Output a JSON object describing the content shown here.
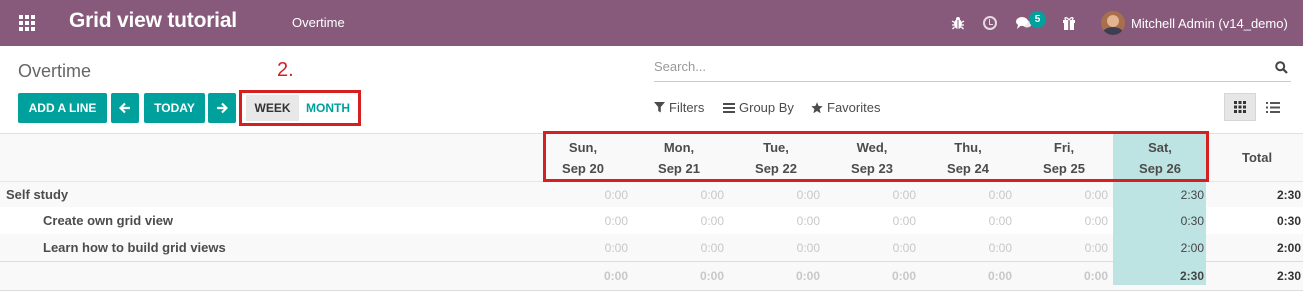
{
  "navbar": {
    "brand": "Grid view tutorial",
    "menu": "Overtime",
    "message_count": "5",
    "user": "Mitchell Admin (v14_demo)"
  },
  "control": {
    "breadcrumb": "Overtime",
    "annotation": "2.",
    "search_placeholder": "Search...",
    "add_line": "ADD A LINE",
    "today": "TODAY",
    "week": "WEEK",
    "month": "MONTH",
    "filters": "Filters",
    "group_by": "Group By",
    "favorites": "Favorites"
  },
  "grid": {
    "days": [
      {
        "day": "Sun,",
        "date": "Sep 20"
      },
      {
        "day": "Mon,",
        "date": "Sep 21"
      },
      {
        "day": "Tue,",
        "date": "Sep 22"
      },
      {
        "day": "Wed,",
        "date": "Sep 23"
      },
      {
        "day": "Thu,",
        "date": "Sep 24"
      },
      {
        "day": "Fri,",
        "date": "Sep 25"
      },
      {
        "day": "Sat,",
        "date": "Sep 26"
      }
    ],
    "total_label": "Total",
    "rows": [
      {
        "label": "Self study",
        "values": [
          "0:00",
          "0:00",
          "0:00",
          "0:00",
          "0:00",
          "0:00",
          "2:30"
        ],
        "total": "2:30"
      },
      {
        "label": "Create own grid view",
        "values": [
          "0:00",
          "0:00",
          "0:00",
          "0:00",
          "0:00",
          "0:00",
          "0:30"
        ],
        "total": "0:30"
      },
      {
        "label": "Learn how to build grid views",
        "values": [
          "0:00",
          "0:00",
          "0:00",
          "0:00",
          "0:00",
          "0:00",
          "2:00"
        ],
        "total": "2:00"
      }
    ],
    "totals": {
      "values": [
        "0:00",
        "0:00",
        "0:00",
        "0:00",
        "0:00",
        "0:00",
        "2:30"
      ],
      "total": "2:30"
    }
  },
  "colors": {
    "brand": "#875a7b",
    "primary": "#00a09d",
    "highlight": "#bde4e2",
    "annotation": "#d42020"
  }
}
